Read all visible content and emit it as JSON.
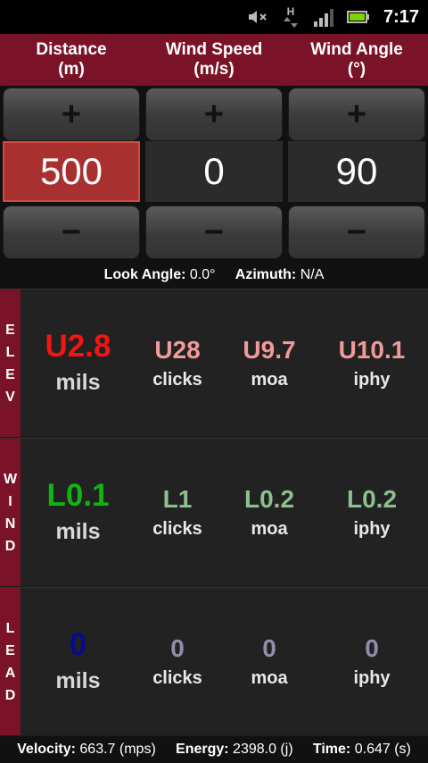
{
  "status": {
    "time": "7:17",
    "network": "H"
  },
  "header": {
    "distance": "Distance",
    "distance_unit": "(m)",
    "wind_speed": "Wind Speed",
    "wind_speed_unit": "(m/s)",
    "wind_angle": "Wind Angle",
    "wind_angle_unit": "(°)"
  },
  "controls": {
    "plus": "+",
    "minus": "−",
    "distance_value": "500",
    "wind_speed_value": "0",
    "wind_angle_value": "90"
  },
  "info": {
    "look_label": "Look Angle:",
    "look_value": "0.0°",
    "azimuth_label": "Azimuth:",
    "azimuth_value": "N/A"
  },
  "elev": {
    "label_letters": [
      "E",
      "L",
      "E",
      "V"
    ],
    "main": "U2.8",
    "main_unit": "mils",
    "clicks": "U28",
    "clicks_unit": "clicks",
    "moa": "U9.7",
    "moa_unit": "moa",
    "iphy": "U10.1",
    "iphy_unit": "iphy",
    "colors": {
      "main": "#f41414",
      "sub": "#f19a9a"
    }
  },
  "wind": {
    "label_letters": [
      "W",
      "I",
      "N",
      "D"
    ],
    "main": "L0.1",
    "main_unit": "mils",
    "clicks": "L1",
    "clicks_unit": "clicks",
    "moa": "L0.2",
    "moa_unit": "moa",
    "iphy": "L0.2",
    "iphy_unit": "iphy",
    "colors": {
      "main": "#12b312",
      "sub": "#8fbf8f"
    }
  },
  "lead": {
    "label_letters": [
      "L",
      "E",
      "A",
      "D"
    ],
    "main": "0",
    "main_unit": "mils",
    "clicks": "0",
    "clicks_unit": "clicks",
    "moa": "0",
    "moa_unit": "moa",
    "iphy": "0",
    "iphy_unit": "iphy",
    "colors": {
      "main": "#0a0a8c",
      "sub": "#8f8fab"
    }
  },
  "footer": {
    "velocity_label": "Velocity:",
    "velocity_value": "663.7 (mps)",
    "energy_label": "Energy:",
    "energy_value": "2398.0 (j)",
    "time_label": "Time:",
    "time_value": "0.647 (s)"
  },
  "colors": {
    "header_bg": "#7a1228",
    "selected_value_bg": "#a8302f"
  }
}
